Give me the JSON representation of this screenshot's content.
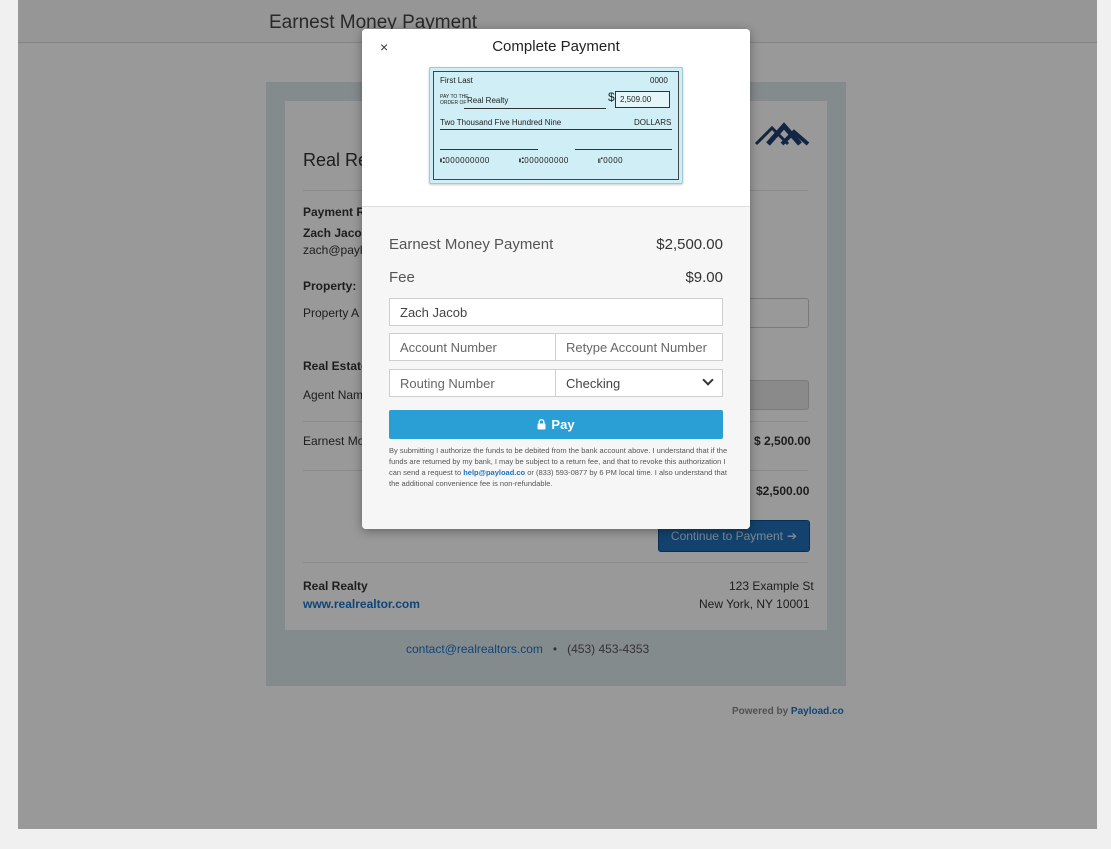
{
  "page": {
    "header_title": "Earnest Money Payment",
    "company_name": "Real Realty",
    "payment_section_label": "Payment R",
    "payer_name": "Zach Jacob",
    "payer_email": "zach@paylc",
    "property_label": "Property:",
    "property_address_label": "Property A",
    "agent_section_label": "Real Estate",
    "agent_name_label": "Agent Nam",
    "earnest_label": "Earnest Mo",
    "earnest_amount": "$ 2,500.00",
    "total_amount": "$2,500.00",
    "continue_label": "Continue to Payment",
    "footer_company": "Real Realty",
    "footer_website": "www.realrealtor.com",
    "footer_street": "123 Example St",
    "footer_city": "New York, NY 10001",
    "contact_email": "contact@realrealtors.com",
    "contact_separator": "•",
    "contact_phone": "(453) 453-4353",
    "powered_by": "Powered by",
    "powered_link": "Payload.co"
  },
  "modal": {
    "title": "Complete Payment",
    "close": "×",
    "check": {
      "name": "First Last",
      "check_number": "0000",
      "pay_to_label_1": "PAY TO THE",
      "pay_to_label_2": "ORDER OF",
      "payee": "Real Realty",
      "dollar_sign": "$",
      "amount": "2,509.00",
      "amount_words": "Two Thousand Five Hundred Nine",
      "dollars_label": "DOLLARS",
      "micr_routing": "⑆000000000",
      "micr_account": "⑆000000000",
      "micr_check": "⑈0000"
    },
    "line_items": [
      {
        "label": "Earnest Money Payment",
        "value": "$2,500.00"
      },
      {
        "label": "Fee",
        "value": "$9.00"
      }
    ],
    "fields": {
      "name_value": "Zach Jacob",
      "account_placeholder": "Account Number",
      "retype_placeholder": "Retype Account Number",
      "routing_placeholder": "Routing Number",
      "account_type": "Checking"
    },
    "pay_label": "Pay",
    "disclaimer_1": "By submitting I authorize the funds to be debited from the bank account above. I understand that if the funds are returned by my bank, I may be subject to a return fee, and that to revoke this authorization I can send a request to ",
    "disclaimer_link": "help@payload.co",
    "disclaimer_2": " or (833) 593-0877 by 6 PM local time. I also understand that the additional convenience fee is non-refundable."
  },
  "colors": {
    "pay_button": "#2a9fd6",
    "link": "#1a73c8",
    "check_bg": "#cfeef5"
  }
}
